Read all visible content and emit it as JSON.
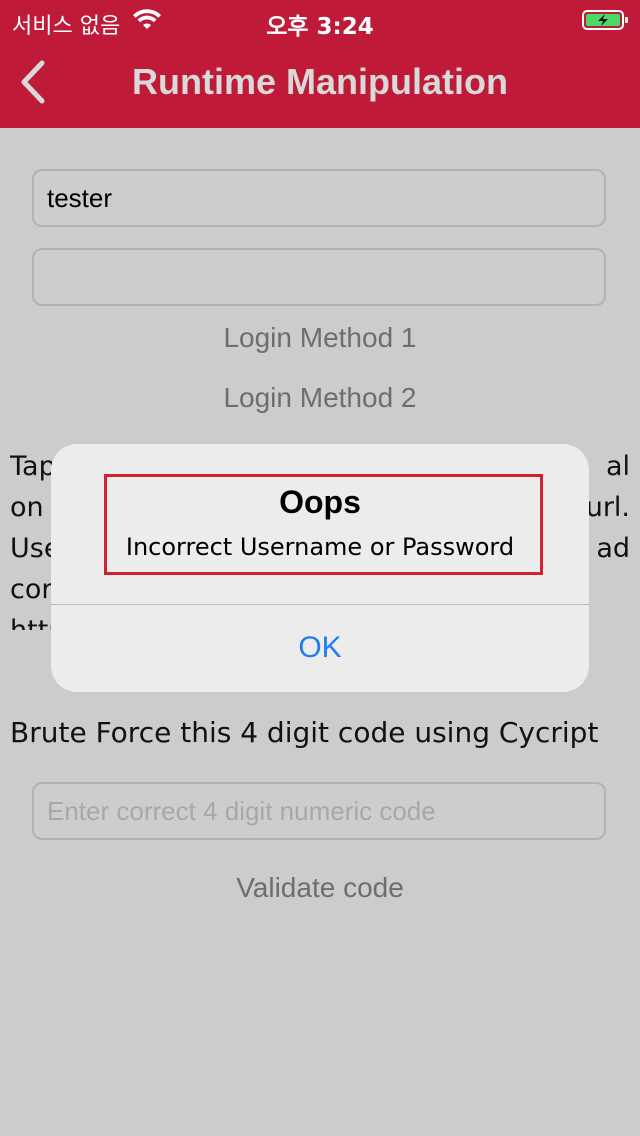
{
  "status_bar": {
    "carrier": "서비스 없음",
    "time": "오후 3:24"
  },
  "nav": {
    "back_icon": "chevron-left-icon",
    "title": "Runtime Manipulation"
  },
  "form": {
    "username_value": "tester",
    "password_value": "",
    "login_method_1": "Login Method 1",
    "login_method_2": "Login Method 2"
  },
  "obscured_text": {
    "visible_left": "Tap\non\nUse\ncon\nhttp",
    "visible_right": "al\nurl.\nad"
  },
  "brute_force": {
    "label": "Brute Force this 4 digit code using Cycript",
    "code_placeholder": "Enter correct 4 digit numeric code",
    "validate_label": "Validate code"
  },
  "alert": {
    "title": "Oops",
    "message": "Incorrect Username or Password",
    "ok_label": "OK"
  },
  "colors": {
    "brand_red": "#bf1a38",
    "highlight_red": "#d2202f",
    "ios_blue": "#1e7ef0"
  }
}
